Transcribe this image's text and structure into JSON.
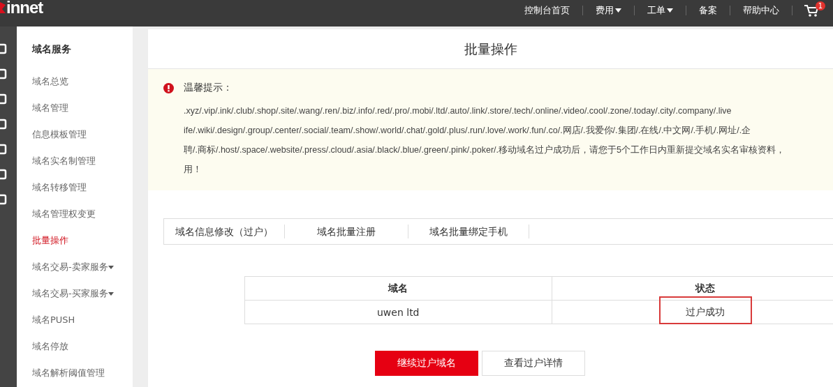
{
  "header": {
    "logo": "innet",
    "nav": [
      {
        "label": "控制台首页",
        "dropdown": false
      },
      {
        "label": "费用",
        "dropdown": true
      },
      {
        "label": "工单",
        "dropdown": true
      },
      {
        "label": "备案",
        "dropdown": false
      },
      {
        "label": "帮助中心",
        "dropdown": false
      }
    ],
    "cart_badge": "1"
  },
  "sidebar": {
    "title": "域名服务",
    "items": [
      {
        "label": "域名总览",
        "selected": false,
        "dropdown": false
      },
      {
        "label": "域名管理",
        "selected": false,
        "dropdown": false
      },
      {
        "label": "信息模板管理",
        "selected": false,
        "dropdown": false
      },
      {
        "label": "域名实名制管理",
        "selected": false,
        "dropdown": false
      },
      {
        "label": "域名转移管理",
        "selected": false,
        "dropdown": false
      },
      {
        "label": "域名管理权变更",
        "selected": false,
        "dropdown": false
      },
      {
        "label": "批量操作",
        "selected": true,
        "dropdown": false
      },
      {
        "label": "域名交易-卖家服务",
        "selected": false,
        "dropdown": true
      },
      {
        "label": "域名交易-买家服务",
        "selected": false,
        "dropdown": true
      },
      {
        "label": "域名PUSH",
        "selected": false,
        "dropdown": false
      },
      {
        "label": "域名停放",
        "selected": false,
        "dropdown": false
      },
      {
        "label": "域名解析阈值管理",
        "selected": false,
        "dropdown": false
      }
    ]
  },
  "page_title": "批量操作",
  "notice": {
    "title": "温馨提示：",
    "lines": [
      ".xyz/.vip/.ink/.club/.shop/.site/.wang/.ren/.biz/.info/.red/.pro/.mobi/.ltd/.auto/.link/.store/.tech/.online/.video/.cool/.zone/.today/.city/.company/.live",
      "ife/.wiki/.design/.group/.center/.social/.team/.show/.world/.chat/.gold/.plus/.run/.love/.work/.fun/.co/.网店/.我爱你/.集团/.在线/.中文网/.手机/.网址/.企",
      "聘/.商标/.host/.space/.website/.press/.cloud/.asia/.black/.blue/.green/.pink/.poker/.移动域名过户成功后，请您于5个工作日内重新提交域名实名审核资料，",
      "用！"
    ]
  },
  "tabs": [
    {
      "label": "域名信息修改（过户）",
      "selected": false
    },
    {
      "label": "域名批量注册",
      "selected": false
    },
    {
      "label": "域名批量绑定手机",
      "selected": false
    }
  ],
  "table": {
    "columns": [
      "域名",
      "状态"
    ],
    "rows": [
      {
        "domain": "uwen ltd",
        "status": "过户成功",
        "highlighted": true
      }
    ]
  },
  "buttons": [
    {
      "label": "继续过户域名",
      "kind": "primary"
    },
    {
      "label": "查看过户详情",
      "kind": "secondary"
    }
  ]
}
